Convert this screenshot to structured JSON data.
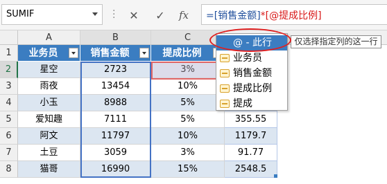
{
  "formula_bar": {
    "name_box": "SUMIF",
    "cancel_glyph": "✕",
    "enter_glyph": "✓",
    "fx_label": "fx",
    "formula_part1": "=[销售金额]",
    "formula_part2": "*[@提成比例]"
  },
  "columns": [
    "A",
    "B",
    "C",
    "D"
  ],
  "rows": [
    "1",
    "2",
    "3",
    "4",
    "5",
    "6",
    "7",
    "8"
  ],
  "table": {
    "headers": [
      "业务员",
      "销售金额",
      "提成比例",
      ""
    ],
    "data": [
      {
        "name": "星空",
        "sales": "2723",
        "rate": "3%",
        "amount": ""
      },
      {
        "name": "雨夜",
        "sales": "13454",
        "rate": "10%",
        "amount": ""
      },
      {
        "name": "小玉",
        "sales": "8988",
        "rate": "5%",
        "amount": ""
      },
      {
        "name": "爱知趣",
        "sales": "7111",
        "rate": "5%",
        "amount": "355.55"
      },
      {
        "name": "阿文",
        "sales": "11797",
        "rate": "10%",
        "amount": "1179.7"
      },
      {
        "name": "土豆",
        "sales": "3059",
        "rate": "3%",
        "amount": "91.77"
      },
      {
        "name": "猫哥",
        "sales": "16990",
        "rate": "15%",
        "amount": "2548.5"
      }
    ]
  },
  "autocomplete": {
    "items": [
      "@ - 此行",
      "业务员",
      "销售金额",
      "提成比例",
      "提成"
    ],
    "tooltip": "仅选择指定列的这一行"
  },
  "colors": {
    "header_fill": "#3b7dc1",
    "band_fill": "#dce6f1",
    "ref_blue": "#4472c4",
    "ref_red": "#e06666",
    "annotation_red": "#e02020"
  }
}
